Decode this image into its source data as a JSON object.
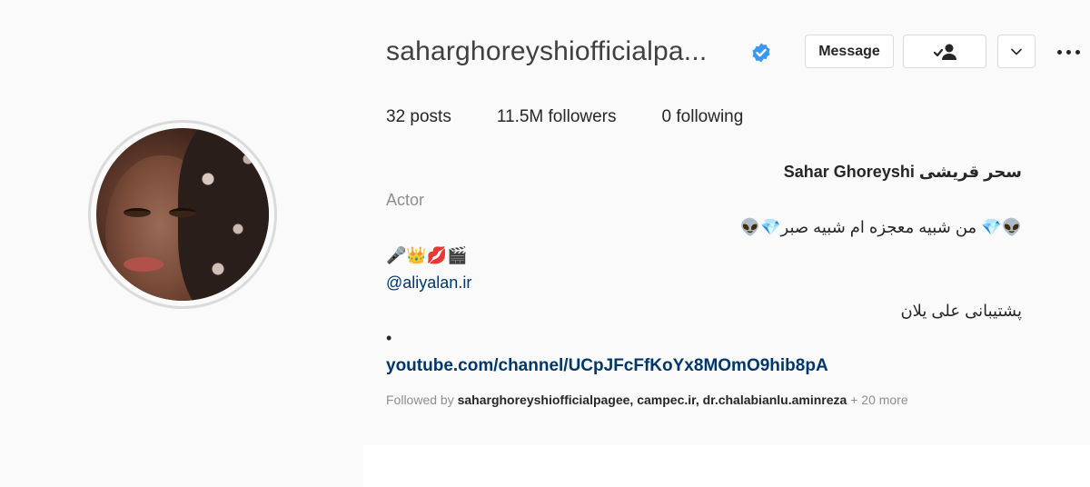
{
  "profile": {
    "username": "saharghoreyshiofficialpa...",
    "verified": true,
    "verified_color": "#3897f0",
    "buttons": {
      "message_label": "Message",
      "follow_icon": "person-check-icon",
      "dropdown_icon": "chevron-down-icon",
      "more_icon": "more-horizontal-icon"
    },
    "stats": {
      "posts_count": "32",
      "posts_label": "posts",
      "followers_count": "11.5M",
      "followers_label": "followers",
      "following_count": "0",
      "following_label": "following"
    },
    "bio": {
      "display_name": "سحر قریشی Sahar Ghoreyshi",
      "category": "Actor",
      "line1": "👽💎 من شبیه معجزه ام شبیه صبر💎👽",
      "line2": "🎤👑💋🎬",
      "mention": "@aliyalan.ir",
      "line3": "پشتیبانی علی یلان",
      "bullet": "•",
      "link": "youtube.com/channel/UCpJFcFfKoYx8MOmO9hib8pA"
    },
    "followed_by": {
      "prefix": "Followed by",
      "names": "saharghoreyshiofficialpagee, campec.ir, dr.chalabianlu.aminreza",
      "more": "+ 20 more"
    }
  }
}
